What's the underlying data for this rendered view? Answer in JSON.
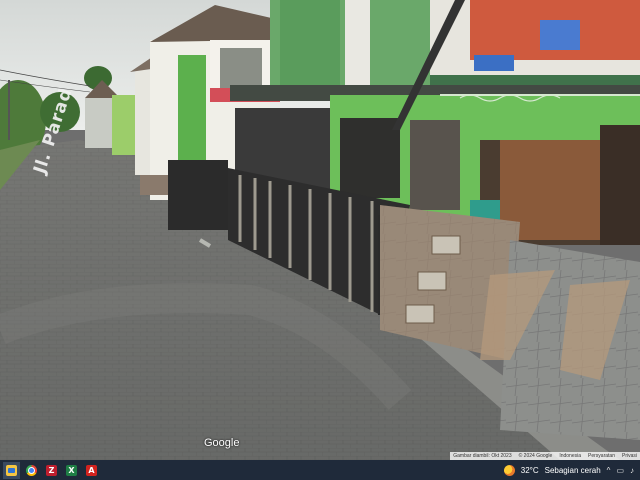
{
  "street_view": {
    "road_label": "Jl. Parad",
    "watermark": "Google",
    "attribution": {
      "capture": "Gambar diambil: Okt 2023",
      "copyright": "© 2024 Google",
      "country": "Indonesia",
      "terms": "Persyaratan",
      "privacy": "Privasi"
    }
  },
  "taskbar": {
    "apps": [
      {
        "name": "File Explorer",
        "icon": "folder-icon",
        "color": "#f5c542",
        "glyph": ""
      },
      {
        "name": "Chrome",
        "icon": "chrome-icon",
        "color": "#34a853",
        "glyph": ""
      },
      {
        "name": "FileZilla",
        "icon": "filezilla-icon",
        "color": "#bf1e2e",
        "glyph": "Z"
      },
      {
        "name": "Excel",
        "icon": "excel-icon",
        "color": "#1e7e45",
        "glyph": "X"
      },
      {
        "name": "Acrobat",
        "icon": "pdf-icon",
        "color": "#d3231f",
        "glyph": "A"
      }
    ],
    "weather": {
      "temperature": "32°C",
      "condition": "Sebagian cerah"
    }
  },
  "colors": {
    "taskbar_bg": "#1f2a3a",
    "sky": "#dfe2e0",
    "road": "#6e6e6e",
    "house_green": "#57a84a",
    "fence": "#2b2b2b"
  }
}
